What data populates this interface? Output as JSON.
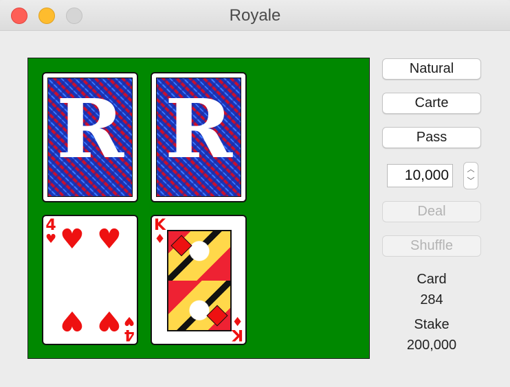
{
  "window": {
    "title": "Royale"
  },
  "board": {
    "top_row": [
      {
        "type": "back",
        "letter": "R"
      },
      {
        "type": "back",
        "letter": "R"
      }
    ],
    "bottom_row": [
      {
        "type": "face",
        "rank": "4",
        "suit": "♥",
        "suit_name": "hearts"
      },
      {
        "type": "face",
        "rank": "K",
        "suit": "♦",
        "suit_name": "diamonds"
      }
    ]
  },
  "controls": {
    "natural_label": "Natural",
    "carte_label": "Carte",
    "pass_label": "Pass",
    "bet_value": "10,000",
    "deal_label": "Deal",
    "shuffle_label": "Shuffle"
  },
  "stats": {
    "card_label": "Card",
    "card_value": "284",
    "stake_label": "Stake",
    "stake_value": "200,000"
  },
  "colors": {
    "felt": "#008800",
    "card_red": "#ee1111",
    "back_blue": "#1a35b8"
  }
}
